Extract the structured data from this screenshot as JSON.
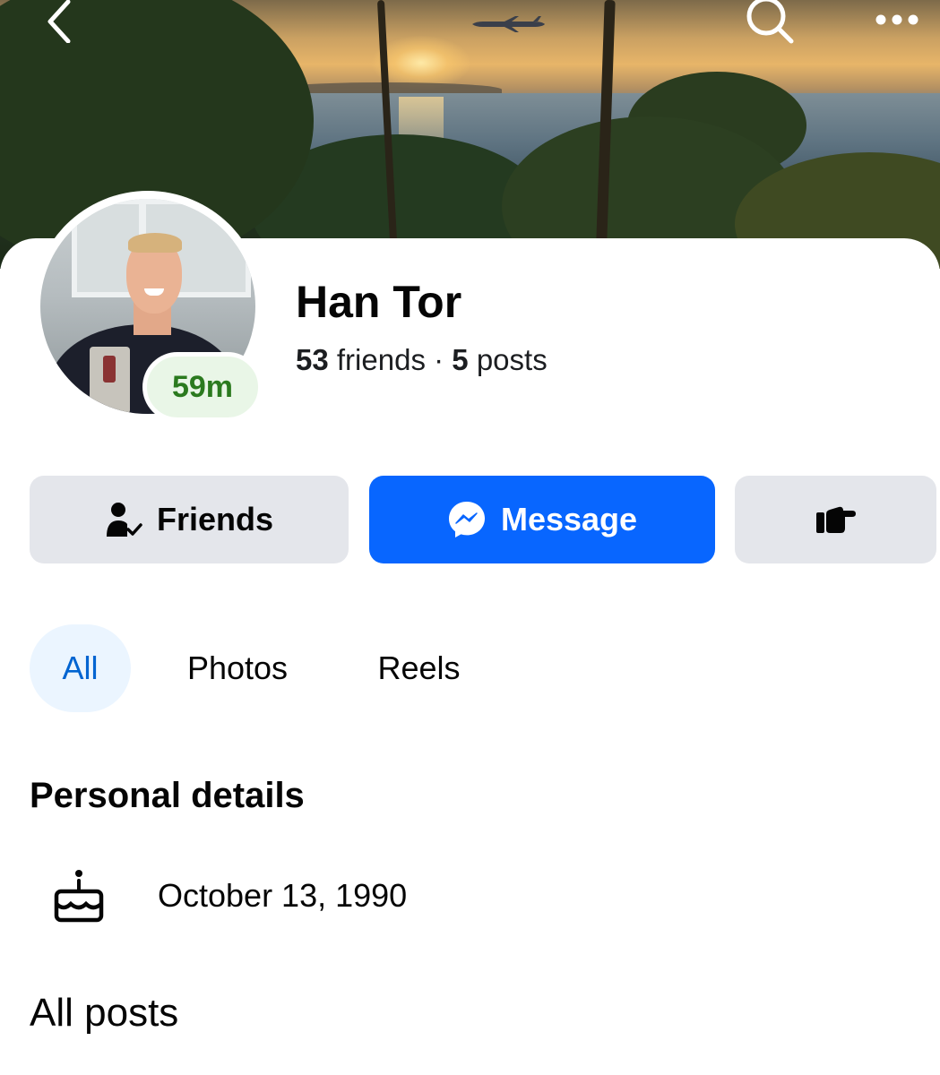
{
  "navigation": {
    "back_icon": "chevron-left-icon",
    "search_icon": "search-icon",
    "more_icon": "more-horizontal-icon"
  },
  "profile": {
    "name": "Han Tor",
    "active_badge": "59m",
    "friends_count": "53",
    "friends_label": "friends",
    "separator": "·",
    "posts_count": "5",
    "posts_label": "posts"
  },
  "actions": {
    "friends_label": "Friends",
    "friends_icon": "person-check-icon",
    "message_label": "Message",
    "message_icon": "messenger-icon",
    "poke_icon": "poke-hand-icon"
  },
  "tabs": [
    {
      "label": "All",
      "selected": true
    },
    {
      "label": "Photos",
      "selected": false
    },
    {
      "label": "Reels",
      "selected": false
    }
  ],
  "personal_details": {
    "title": "Personal details",
    "birthday_icon": "birthday-cake-icon",
    "birthday": "October 13, 1990"
  },
  "all_posts": {
    "title": "All posts"
  },
  "colors": {
    "accent": "#0866ff",
    "tab_selected_bg": "#ebf5ff",
    "tab_selected_text": "#0064d1",
    "button_gray": "#e4e6eb",
    "active_green": "#2b7a1f"
  }
}
